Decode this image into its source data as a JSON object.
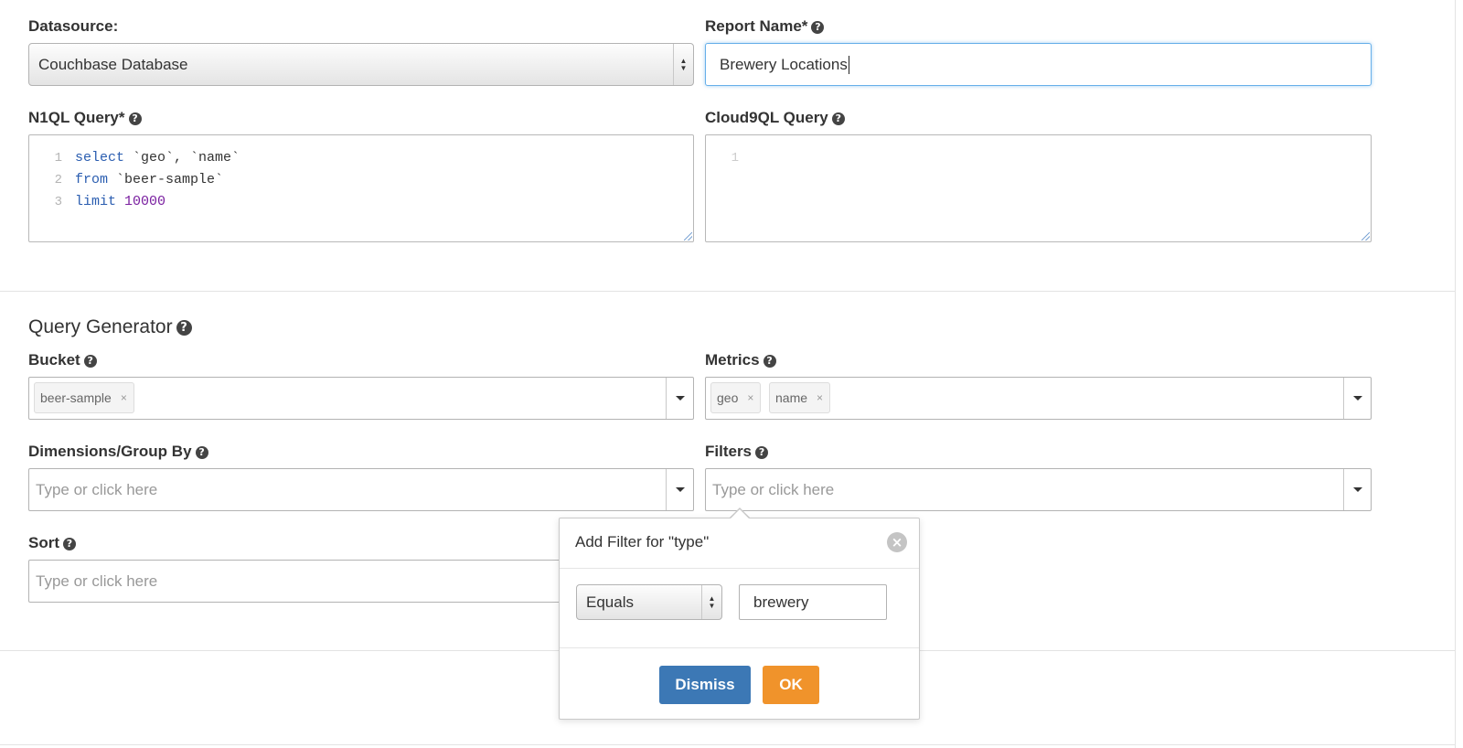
{
  "datasource": {
    "label": "Datasource:",
    "value": "Couchbase Database"
  },
  "report_name": {
    "label": "Report Name*",
    "value": "Brewery Locations"
  },
  "n1ql": {
    "label": "N1QL Query*",
    "lines": [
      {
        "num": "1",
        "kw": "select",
        "rest": " `geo`, `name`"
      },
      {
        "num": "2",
        "kw": "from",
        "rest": " `beer-sample`"
      },
      {
        "num": "3",
        "kw": "limit",
        "rest": " ",
        "numval": "10000"
      }
    ]
  },
  "cloud9ql": {
    "label": "Cloud9QL Query",
    "line_num": "1"
  },
  "query_generator": {
    "title": "Query Generator",
    "bucket": {
      "label": "Bucket",
      "tags": [
        "beer-sample"
      ]
    },
    "metrics": {
      "label": "Metrics",
      "tags": [
        "geo",
        "name"
      ]
    },
    "dimensions": {
      "label": "Dimensions/Group By",
      "placeholder": "Type or click here"
    },
    "filters": {
      "label": "Filters",
      "placeholder": "Type or click here"
    },
    "sort": {
      "label": "Sort",
      "placeholder": "Type or click here"
    }
  },
  "filter_popover": {
    "title": "Add Filter for \"type\"",
    "operator": "Equals",
    "value": "brewery",
    "dismiss_label": "Dismiss",
    "ok_label": "OK"
  },
  "icons": {
    "help": "?",
    "remove": "×",
    "close": "×"
  },
  "colors": {
    "focus_border": "#66afe9",
    "dismiss_button": "#3c78b5",
    "ok_button": "#f0932b",
    "keyword": "#2a5db0",
    "number": "#7a1fa0"
  }
}
